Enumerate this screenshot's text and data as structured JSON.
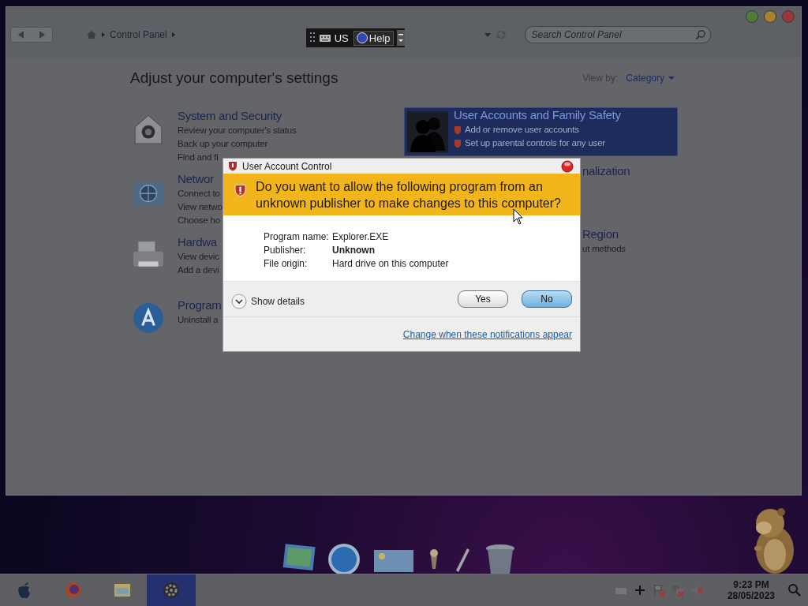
{
  "control_panel": {
    "window_buttons": [
      {
        "color": "#4f7a3a"
      },
      {
        "color": "#a8822e"
      },
      {
        "color": "#9a3838"
      }
    ],
    "breadcrumb": "Control Panel",
    "language_bar": {
      "language": "US",
      "help": "Help"
    },
    "search": {
      "placeholder": "Search Control Panel"
    },
    "heading": "Adjust your computer's settings",
    "view_by": {
      "label": "View by:",
      "value": "Category"
    },
    "columns": [
      [
        {
          "kind": "security",
          "selected": false,
          "title": "System and Security",
          "links": [
            "Review your computer's status",
            "Back up your computer",
            "Find and fi"
          ]
        },
        {
          "kind": "network",
          "selected": false,
          "title": "Networ",
          "links": [
            "Connect to",
            "View netwo",
            "Choose ho"
          ]
        },
        {
          "kind": "printer",
          "selected": false,
          "title": "Hardwa",
          "links": [
            "View devic",
            "Add a devi"
          ]
        },
        {
          "kind": "apps",
          "selected": false,
          "title": "Program",
          "links": [
            "Uninstall a"
          ]
        }
      ],
      [
        {
          "kind": "users",
          "selected": true,
          "title": "User Accounts and Family Safety",
          "links": [
            "Add or remove user accounts",
            "Set up parental controls for any user"
          ]
        },
        {
          "selected": false,
          "title": "nalization"
        },
        {
          "selected": false,
          "title": "Region",
          "links": [
            "ut methods"
          ]
        }
      ]
    ]
  },
  "dialog": {
    "title": "User Account Control",
    "question": "Do you want to allow the following program from an unknown publisher to make changes to this computer?",
    "details": [
      {
        "label": "Program name:",
        "value": "Explorer.EXE",
        "bold": false
      },
      {
        "label": "Publisher:",
        "value": "Unknown",
        "bold": true
      },
      {
        "label": "File origin:",
        "value": "Hard drive on this computer",
        "bold": false
      }
    ],
    "show_details": "Show details",
    "buttons": [
      {
        "label": "Yes",
        "default": false
      },
      {
        "label": "No",
        "default": true
      }
    ],
    "link": "Change when these notifications appear"
  },
  "dock": [
    {
      "kind": "photos"
    },
    {
      "kind": "compass"
    },
    {
      "kind": "card"
    },
    {
      "kind": "lamp"
    },
    {
      "kind": "pen"
    },
    {
      "kind": "trash"
    }
  ],
  "taskbar": {
    "apps": [
      {
        "kind": "apple",
        "selected": false
      },
      {
        "kind": "firefox",
        "selected": false
      },
      {
        "kind": "files",
        "selected": false
      },
      {
        "kind": "settings",
        "selected": true
      }
    ],
    "tray": [
      {
        "kind": "keyboard"
      },
      {
        "kind": "plus"
      },
      {
        "kind": "flag"
      },
      {
        "kind": "network"
      },
      {
        "kind": "speaker"
      }
    ],
    "time": "9:23 PM",
    "date": "28/05/2023"
  }
}
